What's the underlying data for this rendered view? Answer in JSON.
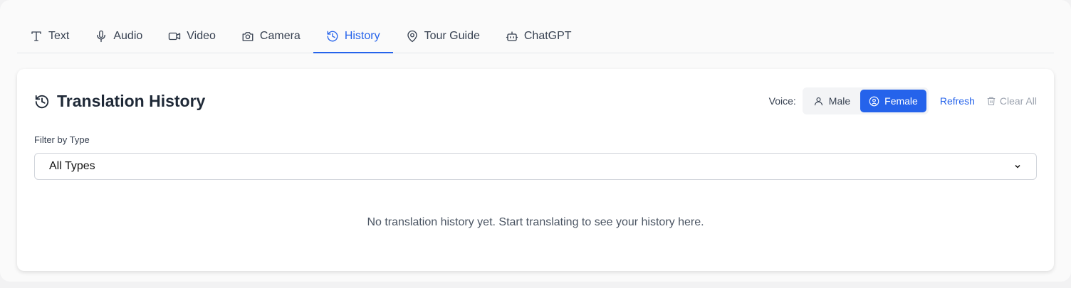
{
  "tabs": [
    {
      "label": "Text",
      "icon": "type-icon"
    },
    {
      "label": "Audio",
      "icon": "microphone-icon"
    },
    {
      "label": "Video",
      "icon": "video-icon"
    },
    {
      "label": "Camera",
      "icon": "camera-icon"
    },
    {
      "label": "History",
      "icon": "history-icon",
      "active": true
    },
    {
      "label": "Tour Guide",
      "icon": "map-pin-icon"
    },
    {
      "label": "ChatGPT",
      "icon": "bot-icon"
    }
  ],
  "panel": {
    "title": "Translation History",
    "voice_label": "Voice:",
    "voice_options": [
      "Male",
      "Female"
    ],
    "voice_selected": "Female",
    "refresh": "Refresh",
    "clear_all": "Clear All",
    "filter_label": "Filter by Type",
    "filter_value": "All Types",
    "empty_message": "No translation history yet. Start translating to see your history here."
  },
  "colors": {
    "accent": "#2563eb",
    "disabled": "#9ca3af"
  }
}
